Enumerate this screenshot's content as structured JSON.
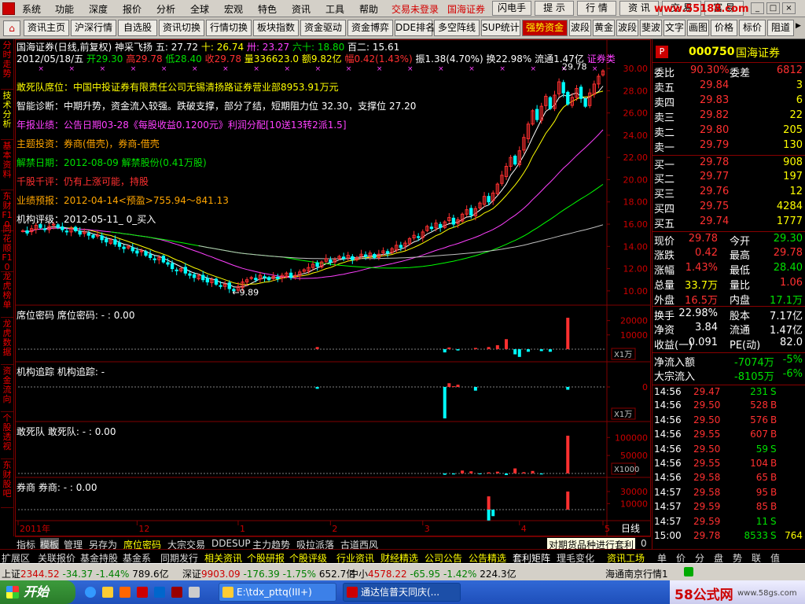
{
  "menu": {
    "items": [
      "系统",
      "功能",
      "深度",
      "报价",
      "分析",
      "全球",
      "宏观",
      "特色",
      "资讯",
      "工具",
      "帮助"
    ],
    "login": "交易未登录",
    "broker": "国海证券",
    "buttons": [
      "闪电手",
      "提 示",
      "行 情",
      "资 讯",
      "交 易",
      "富 易"
    ],
    "watermark": "www.55188.com"
  },
  "toolbar": {
    "buttons": [
      "资讯主页",
      "沪深行情",
      "自选股",
      "资讯切换",
      "行情切换",
      "板块指数",
      "资金驱动",
      "资金博弈",
      "DDE排名",
      "多空阵线",
      "SUP统计",
      "强势资金",
      "波段",
      "黄金",
      "波段",
      "斐波",
      "文字",
      "画图",
      "价格",
      "标价",
      "阻道"
    ],
    "active_index": 11
  },
  "left_tabs": [
    "分时走势",
    "技术分析",
    "基本资料",
    "东财F10",
    "同花顺F10",
    "龙虎榜单",
    "龙虎数据",
    "资金流向",
    "个股透视",
    "东财股吧"
  ],
  "header": {
    "title": "国海证券(日线,前复权)",
    "ma_name": "神采飞扬",
    "ma_values": [
      "五: 27.72",
      "十: 26.74",
      "卅: 23.27",
      "六十: 18.80",
      "百二: 15.61"
    ],
    "date": "2012/05/18/五",
    "open": "开29.30",
    "high": "高29.78",
    "low": "低28.40",
    "close": "收29.78",
    "volume": "量336623.0",
    "amount": "额9.82亿",
    "change": "幅0.42(1.43%)",
    "amplitude": "振1.38(4.70%)",
    "turnover": "换22.98%",
    "float_cap": "流通1.47亿",
    "sector": "证券类"
  },
  "info_lines": [
    {
      "label": "敢死队席位：",
      "text": "中国中投证券有限责任公司无锡清扬路证券营业部8953.91万元"
    },
    {
      "label": "智能诊断：",
      "text": "中期升势，资金流入较强。跌破支撑，部分了结，短期阻力位 32.30，支撑位 27.20"
    },
    {
      "label": "年报业绩：",
      "text": "公告日期03-28《每股收益0.1200元》利润分配[10送13转2派1.5]"
    },
    {
      "label": "主题投资：",
      "text": "券商(借壳)，券商-借壳"
    },
    {
      "label": "解禁日期：",
      "text": "2012-08-09 解禁股份(0.41万股)"
    },
    {
      "label": "千股千评：",
      "text": "仍有上涨可能，持股"
    },
    {
      "label": "业绩预报：",
      "text": "2012-04-14<预盈>755.94～841.13"
    },
    {
      "label": "机构评级：",
      "text": "2012-05-11_ 0_买入"
    }
  ],
  "colors": {
    "candle_up": "#ff3030",
    "candle_down": "#00ffff",
    "ma5": "#ffffff",
    "ma10": "#ffff00",
    "ma30": "#ff40ff",
    "ma60": "#00ff00",
    "ma120": "#c0c0c0",
    "grid": "#800000"
  },
  "chart_data": [
    {
      "type": "candlestick",
      "title": "国海证券(日线,前复权)",
      "ylim": [
        9,
        30.5
      ],
      "yticks": [
        10,
        12,
        14,
        16,
        18,
        20,
        22,
        24,
        26,
        28,
        30
      ],
      "xticks": [
        "2011年",
        "12",
        "1",
        "2",
        "3",
        "4",
        "5"
      ],
      "annotations": [
        {
          "text": "29.78",
          "where": "high"
        },
        {
          "text": "9.89",
          "where": "low"
        }
      ],
      "closes": [
        15.4,
        15.2,
        15.6,
        15.9,
        15.7,
        15.5,
        15.8,
        16.0,
        15.7,
        15.5,
        15.3,
        15.6,
        15.4,
        15.1,
        15.3,
        15.0,
        14.8,
        15.0,
        14.6,
        14.4,
        14.6,
        14.2,
        14.0,
        13.8,
        14.0,
        13.6,
        13.4,
        13.6,
        13.2,
        13.0,
        12.8,
        13.0,
        12.6,
        12.4,
        12.0,
        11.8,
        12.0,
        11.6,
        11.4,
        11.2,
        11.4,
        11.0,
        10.8,
        11.0,
        10.6,
        10.4,
        10.6,
        10.2,
        10.0,
        10.4,
        10.8,
        11.0,
        11.2,
        11.0,
        11.4,
        11.2,
        11.0,
        11.3,
        11.1,
        11.4,
        11.6,
        11.2,
        11.4,
        11.7,
        11.9,
        12.1,
        12.4,
        12.2,
        12.6,
        12.9,
        12.6,
        12.8,
        13.1,
        12.9,
        13.2,
        12.8,
        13.0,
        13.3,
        13.1,
        13.4,
        13.0,
        13.3,
        13.6,
        13.4,
        13.8,
        14.1,
        13.9,
        14.3,
        14.7,
        15.0,
        14.8,
        15.3,
        15.8,
        15.6,
        16.1,
        15.7,
        16.2,
        16.6,
        16.0,
        16.4,
        16.9,
        17.3,
        16.8,
        17.4,
        17.9,
        18.5,
        18.0,
        18.8,
        19.6,
        20.4,
        21.2,
        22.0,
        21.4,
        22.6,
        23.8,
        25.0,
        26.2,
        25.4,
        26.6,
        27.5,
        26.4,
        27.6,
        28.8,
        27.8,
        26.8,
        27.4,
        28.2,
        27.3,
        26.6,
        27.8,
        28.6,
        29.3,
        29.78
      ],
      "volume_label": "量336623.0"
    },
    {
      "type": "bar",
      "title": "席位密码",
      "subtitle": "席位密码: -",
      "value_label": ": 0.00",
      "yticks": [
        10000,
        20000
      ],
      "unit": "X1万",
      "values": [
        {
          "i": 67,
          "v": 1500
        },
        {
          "i": 96,
          "v": -2500
        },
        {
          "i": 97,
          "v": 1200
        },
        {
          "i": 99,
          "v": -1000
        },
        {
          "i": 103,
          "v": 900
        },
        {
          "i": 106,
          "v": 1500
        },
        {
          "i": 108,
          "v": 2800
        },
        {
          "i": 110,
          "v": 7000
        },
        {
          "i": 112,
          "v": -4000
        },
        {
          "i": 113,
          "v": -6000
        },
        {
          "i": 115,
          "v": -2000
        },
        {
          "i": 118,
          "v": -1500
        },
        {
          "i": 120,
          "v": -2000
        },
        {
          "i": 124,
          "v": 22000
        }
      ]
    },
    {
      "type": "bar",
      "title": "机构追踪",
      "subtitle": "机构追踪: -",
      "value_label": "",
      "yticks": [
        0
      ],
      "unit": "X1万",
      "values": [
        {
          "i": 67,
          "v": -200
        },
        {
          "i": 96,
          "v": -3400
        },
        {
          "i": 97,
          "v": 1000
        },
        {
          "i": 98,
          "v": 200
        },
        {
          "i": 99,
          "v": 600
        },
        {
          "i": 103,
          "v": -400
        },
        {
          "i": 124,
          "v": -300
        }
      ]
    },
    {
      "type": "bar",
      "title": "敢死队",
      "subtitle": "敢死队: -",
      "value_label": ": 0.00",
      "yticks": [
        50000,
        100000
      ],
      "unit": "X1000",
      "values": [
        {
          "i": 96,
          "v": -4000
        },
        {
          "i": 98,
          "v": -3000
        },
        {
          "i": 100,
          "v": 8000
        },
        {
          "i": 102,
          "v": 6000
        },
        {
          "i": 104,
          "v": -2500
        },
        {
          "i": 106,
          "v": 3000
        },
        {
          "i": 108,
          "v": 5000
        },
        {
          "i": 110,
          "v": -5000
        },
        {
          "i": 112,
          "v": 14000
        },
        {
          "i": 114,
          "v": 3500
        },
        {
          "i": 116,
          "v": 7000
        },
        {
          "i": 118,
          "v": -3000
        },
        {
          "i": 124,
          "v": 105000
        }
      ]
    },
    {
      "type": "bar",
      "title": "券商",
      "subtitle": "券商: -",
      "value_label": ": 0.00",
      "yticks": [
        10000,
        30000
      ],
      "unit": "X1000",
      "values": [
        {
          "i": 106,
          "v": -20000
        },
        {
          "i": 106,
          "v": 22000
        },
        {
          "i": 107,
          "v": -12000
        },
        {
          "i": 124,
          "v": 30000
        }
      ]
    }
  ],
  "indicator_labels": {
    "p1": "席位密码",
    "p1_sub": "席位密码: -",
    "p1_val": ": 0.00",
    "p2": "机构追踪",
    "p2_sub": "机构追踪: -",
    "p3": "敢死队",
    "p3_sub": "敢死队: -",
    "p3_val": ": 0.00",
    "p4": "券商",
    "p4_sub": "券商: -",
    "p4_val": ": 0.00",
    "unit1": "X1万",
    "unit3": "X1000",
    "yt1": "20000",
    "yt1b": "10000",
    "yt2": "0",
    "yt3": "100000",
    "yt3b": "50000",
    "yt4": "30000",
    "yt4b": "10000",
    "period": "日线"
  },
  "quote": {
    "code": "000750",
    "name": "国海证券",
    "p_badge": "P",
    "weibi_label": "委比",
    "weibi": "90.30%",
    "weicha_label": "委差",
    "weicha": "6812",
    "sell": [
      {
        "label": "卖五",
        "price": "29.84",
        "vol": "3"
      },
      {
        "label": "卖四",
        "price": "29.83",
        "vol": "6"
      },
      {
        "label": "卖三",
        "price": "29.82",
        "vol": "22"
      },
      {
        "label": "卖二",
        "price": "29.80",
        "vol": "205"
      },
      {
        "label": "卖一",
        "price": "29.79",
        "vol": "130"
      }
    ],
    "buy": [
      {
        "label": "买一",
        "price": "29.78",
        "vol": "908"
      },
      {
        "label": "买二",
        "price": "29.77",
        "vol": "197"
      },
      {
        "label": "买三",
        "price": "29.76",
        "vol": "12"
      },
      {
        "label": "买四",
        "price": "29.75",
        "vol": "4284"
      },
      {
        "label": "买五",
        "price": "29.74",
        "vol": "1777"
      }
    ],
    "stats": [
      {
        "l1": "现价",
        "v1": "29.78",
        "c1": "red",
        "l2": "今开",
        "v2": "29.30",
        "c2": "grn"
      },
      {
        "l1": "涨跌",
        "v1": "0.42",
        "c1": "red",
        "l2": "最高",
        "v2": "29.78",
        "c2": "red"
      },
      {
        "l1": "涨幅",
        "v1": "1.43%",
        "c1": "red",
        "l2": "最低",
        "v2": "28.40",
        "c2": "grn"
      },
      {
        "l1": "总量",
        "v1": "33.7万",
        "c1": "yel",
        "l2": "量比",
        "v2": "1.06",
        "c2": "red"
      },
      {
        "l1": "外盘",
        "v1": "16.5万",
        "c1": "red",
        "l2": "内盘",
        "v2": "17.1万",
        "c2": "grn"
      },
      {
        "l1": "换手",
        "v1": "22.98%",
        "c1": "wht",
        "l2": "股本",
        "v2": "7.17亿",
        "c2": "wht"
      },
      {
        "l1": "净资",
        "v1": "3.84",
        "c1": "wht",
        "l2": "流通",
        "v2": "1.47亿",
        "c2": "wht"
      },
      {
        "l1": "收益(一)",
        "v1": "0.091",
        "c1": "wht",
        "l2": "PE(动)",
        "v2": "82.0",
        "c2": "wht"
      }
    ],
    "flow": [
      {
        "label": "净流入额",
        "value": "-7074万",
        "pct": "-5%"
      },
      {
        "label": "大宗流入",
        "value": "-8105万",
        "pct": "-6%"
      }
    ],
    "ticks": [
      {
        "t": "14:56",
        "p": "29.47",
        "v": "231",
        "s": "S"
      },
      {
        "t": "14:56",
        "p": "29.50",
        "v": "528",
        "s": "B"
      },
      {
        "t": "14:56",
        "p": "29.50",
        "v": "576",
        "s": "B"
      },
      {
        "t": "14:56",
        "p": "29.55",
        "v": "607",
        "s": "B"
      },
      {
        "t": "14:56",
        "p": "29.50",
        "v": "59",
        "s": "S"
      },
      {
        "t": "14:56",
        "p": "29.55",
        "v": "104",
        "s": "B"
      },
      {
        "t": "14:56",
        "p": "29.58",
        "v": "65",
        "s": "B"
      },
      {
        "t": "14:57",
        "p": "29.58",
        "v": "95",
        "s": "B"
      },
      {
        "t": "14:57",
        "p": "29.59",
        "v": "85",
        "s": "B"
      },
      {
        "t": "14:57",
        "p": "29.59",
        "v": "11",
        "s": "S"
      },
      {
        "t": "15:00",
        "p": "29.78",
        "v": "8533",
        "s": "S",
        "extra": "764"
      }
    ]
  },
  "tabs1": [
    "指标",
    "模板",
    "管理",
    "另存为",
    "席位密码",
    "大宗交易",
    "DDE",
    "SUP",
    "主力趋势",
    "吸拉派落",
    "古道西风"
  ],
  "tabs1_extra": "对期货品种进行套利",
  "tabs1_page": "0",
  "tabs2": [
    "扩展区",
    "关联报价",
    "基金持股",
    "基金系",
    "同期发行",
    "相关资讯",
    "个股研报",
    "个股评级",
    "行业资讯",
    "财经精选",
    "公司公告",
    "公告精选",
    "套利矩阵",
    "理毛变化"
  ],
  "tabs2_right": [
    "资讯工场",
    "单",
    "价",
    "分",
    "盘",
    "势",
    "联",
    "值"
  ],
  "statusbar": [
    {
      "name": "上证",
      "val": "2344.52",
      "chg": "-34.37",
      "pct": "-1.44%",
      "amt": "789.6亿"
    },
    {
      "name": "深证",
      "val": "9903.09",
      "chg": "-176.39",
      "pct": "-1.75%",
      "amt": "652.7亿"
    },
    {
      "name": "中小",
      "val": "4578.22",
      "chg": "-65.95",
      "pct": "-1.42%",
      "amt": "224.3亿"
    }
  ],
  "status_right": "海通南京行情1",
  "taskbar": {
    "start": "开始",
    "items": [
      "E:\\tdx_pttq(III+)",
      "通达信普天同庆(..."
    ],
    "brand": "58公式网",
    "brand_url": "www.58gs.com"
  }
}
